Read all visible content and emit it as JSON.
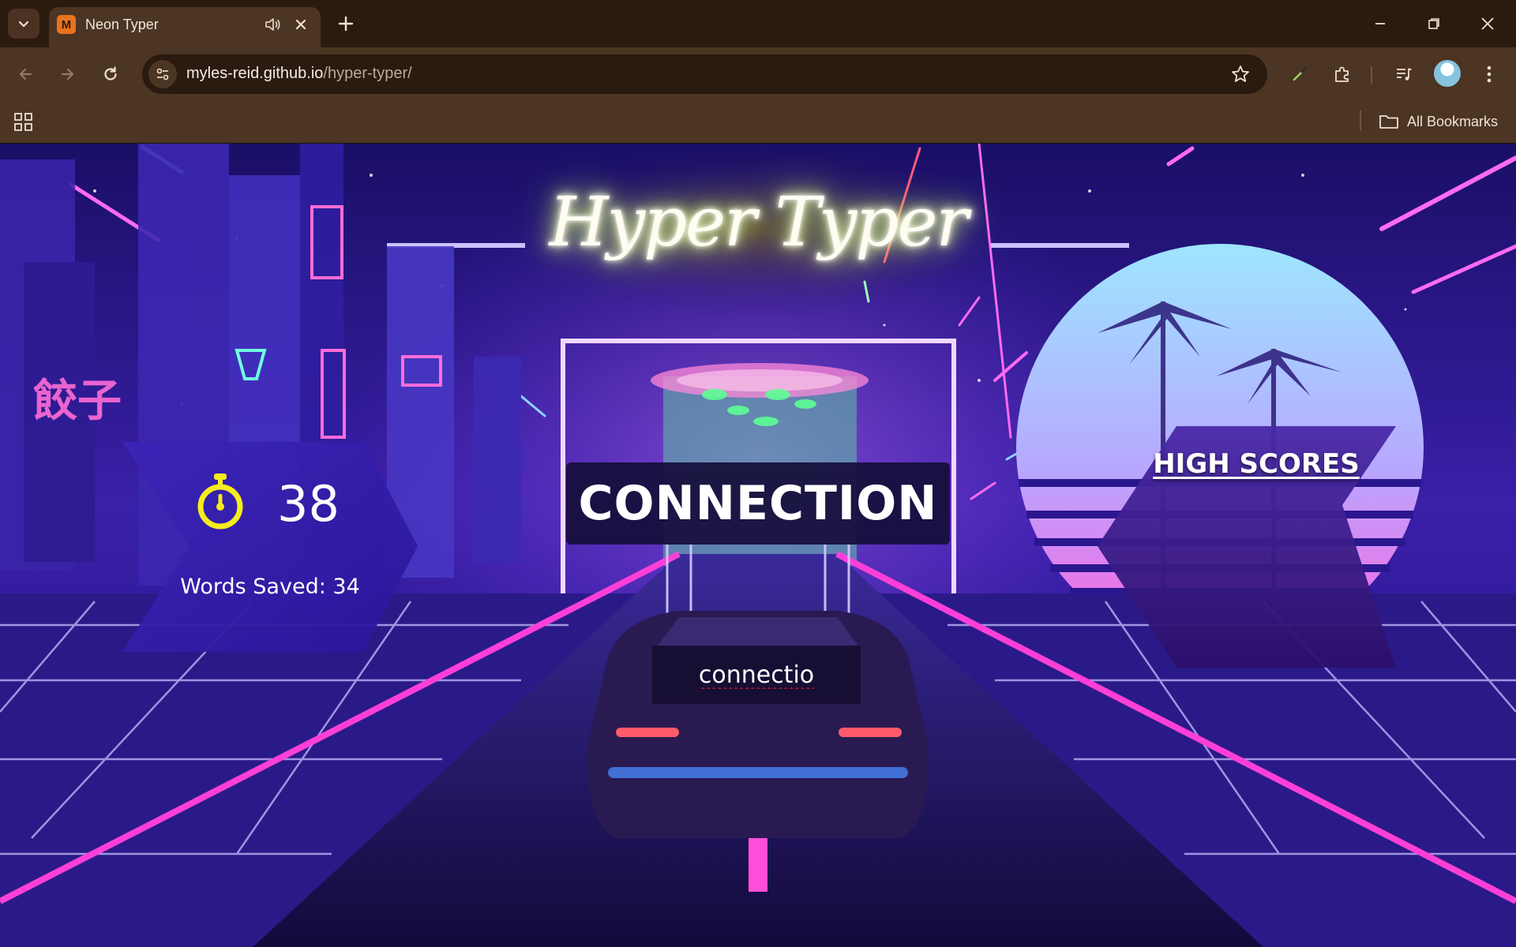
{
  "browser": {
    "tab": {
      "title": "Neon Typer",
      "favicon_letter": "M"
    },
    "omnibox": {
      "url_host": "myles-reid.github.io",
      "url_path": "/hyper-typer/"
    },
    "bookmarks_bar": {
      "all_bookmarks_label": "All Bookmarks"
    }
  },
  "game": {
    "title": "Hyper Typer",
    "timer": {
      "seconds": "38"
    },
    "words_saved": "Words Saved: 34",
    "current_word": "CONNECTION",
    "typed_text": "connectio",
    "high_scores_label": "HIGH SCORES"
  },
  "colors": {
    "chrome_dark": "#2b1a0e",
    "chrome_mid": "#4c3522",
    "favicon": "#e9731f",
    "timer_icon": "#f5ec1c",
    "neon_pink": "#ff3fd8",
    "neon_blue": "#6f7bff"
  }
}
